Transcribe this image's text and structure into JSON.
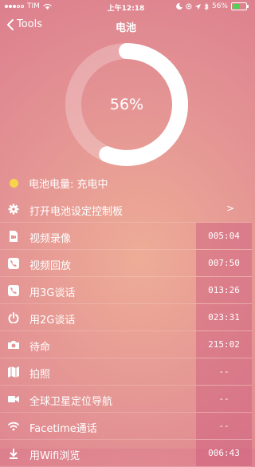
{
  "status_bar": {
    "carrier": "TIM",
    "time": "上午12:18",
    "battery_percent": "56%",
    "battery_level": 0.56,
    "battery_color": "#52d155"
  },
  "nav": {
    "back_label": "Tools",
    "title": "电池",
    "back_icon": "chevron-left-icon"
  },
  "gauge": {
    "percent_text": "56%",
    "level": 0.56
  },
  "battery_status": {
    "label": "电池电量: 充电中",
    "dot_color": "#f7d44a"
  },
  "settings": {
    "label": "打开电池设定控制板",
    "chevron": ">",
    "icon": "gear-icon"
  },
  "rows": [
    {
      "label": "视频录像",
      "value": "005:04",
      "icon": "video-file-icon"
    },
    {
      "label": "视频回放",
      "value": "007:50",
      "icon": "phone-icon"
    },
    {
      "label": "用3G谈话",
      "value": "013:26",
      "icon": "phone-icon"
    },
    {
      "label": "用2G谈话",
      "value": "023:31",
      "icon": "power-icon"
    },
    {
      "label": "待命",
      "value": "215:02",
      "icon": "camera-icon"
    },
    {
      "label": "拍照",
      "value": "--",
      "icon": "map-icon"
    },
    {
      "label": "全球卫星定位导航",
      "value": "--",
      "icon": "video-camera-icon"
    },
    {
      "label": "Facetime通话",
      "value": "--",
      "icon": "wifi-icon"
    },
    {
      "label": "用Wifi浏览",
      "value": "006:43",
      "icon": "download-icon"
    }
  ]
}
